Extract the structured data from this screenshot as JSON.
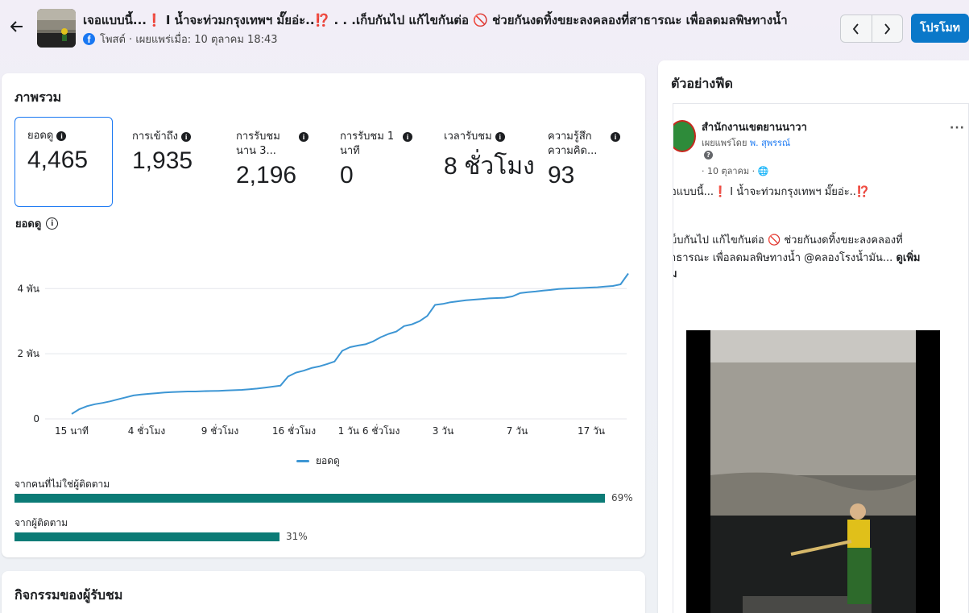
{
  "header": {
    "title": "เจอแบบนี้...❗ I น้ำจะท่วมกรุงเทพฯ มั๊ยอ่ะ..⁉️ . . .เก็บกันไป แก้ไขกันต่อ 🚫 ช่วยกันงดทิ้งขยะลงคลองที่สาธารณะ เพื่อลดมลพิษทางน้ำ",
    "meta": "โพสต์ · เผยแพร่เมื่อ: 10 ตุลาคม 18:43",
    "promote_label": "โปรโมท",
    "brand_color": "#0a78c9"
  },
  "overview": {
    "title": "ภาพรวม",
    "metrics": [
      {
        "label": "ยอดดู",
        "value": "4,465"
      },
      {
        "label": "การเข้าถึง",
        "value": "1,935"
      },
      {
        "label": "การรับชม นาน 3...",
        "value": "2,196"
      },
      {
        "label": "การรับชม 1 นาที",
        "value": "0"
      },
      {
        "label": "เวลารับชม",
        "value": "8 ชั่วโมง"
      },
      {
        "label": "ความรู้สึก ความคิด...",
        "value": "93"
      }
    ],
    "chart_label": "ยอดดู",
    "legend_label": "ยอดดู",
    "audience": [
      {
        "label": "จากคนที่ไม่ใช่ผู้ติดตาม",
        "percent": 69,
        "display": "69%"
      },
      {
        "label": "จากผู้ติดตาม",
        "percent": 31,
        "display": "31%"
      }
    ],
    "bar_color": "#0c7b76"
  },
  "chart_data": {
    "type": "line",
    "title": "ยอดดู",
    "x_ticks": [
      "15 นาที",
      "4 ชั่วโมง",
      "9 ชั่วโมง",
      "16 ชั่วโมง",
      "1 วัน 6 ชั่วโมง",
      "3 วัน",
      "7 วัน",
      "17 วัน"
    ],
    "y_ticks": [
      "0",
      "2 พัน",
      "4 พัน"
    ],
    "ylim": [
      0,
      4600
    ],
    "series": [
      {
        "name": "ยอดดู",
        "color": "#3d96d4",
        "values": [
          150,
          300,
          390,
          450,
          490,
          540,
          600,
          660,
          720,
          750,
          770,
          790,
          810,
          820,
          830,
          840,
          840,
          850,
          855,
          860,
          870,
          880,
          890,
          910,
          930,
          960,
          990,
          1020,
          1300,
          1420,
          1480,
          1560,
          1610,
          1680,
          1760,
          2090,
          2200,
          2250,
          2290,
          2380,
          2510,
          2610,
          2680,
          2850,
          2900,
          3000,
          3160,
          3500,
          3530,
          3580,
          3610,
          3640,
          3660,
          3680,
          3700,
          3710,
          3720,
          3760,
          3860,
          3890,
          3910,
          3940,
          3960,
          3990,
          4000,
          4010,
          4020,
          4030,
          4040,
          4060,
          4080,
          4130,
          4465
        ]
      }
    ],
    "grid": true,
    "legend": "bottom-center"
  },
  "activity": {
    "title": "กิจกรรมของผู้รับชม"
  },
  "feed": {
    "title": "ตัวอย่างฟีด",
    "page_name": "สำนักงานเขตยานนาวา",
    "published_by_prefix": "เผยแพร่โดย ",
    "published_by_name": "พ. สุพรรณ์",
    "date": "· 10 ตุลาคม ·",
    "line1": "อแบบนี้...❗ I น้ำจะท่วมกรุงเทพฯ มั๊ยอ่ะ..⁉️",
    "line2": "บ็บกันไป แก้ไขกันต่อ 🚫 ช่วยกันงดทิ้งขยะลงคลองที่",
    "line3": "าธารณะ เพื่อลดมลพิษทางน้ำ @คลองโรงน้ำมัน...",
    "see_more": "ดูเพิ่ม",
    "line4": "ม"
  }
}
